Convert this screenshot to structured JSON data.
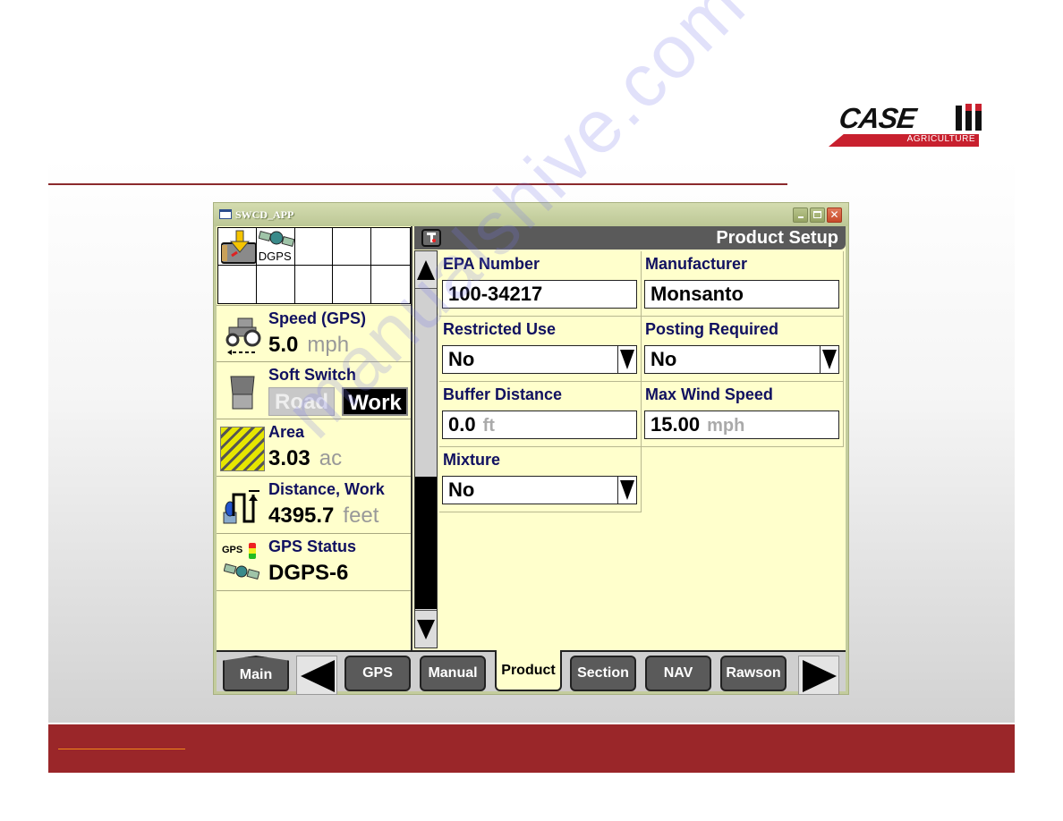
{
  "brand": {
    "logo_word": "CASE",
    "logo_sub": "AGRICULTURE",
    "accent_color": "#9a2629",
    "logo_red": "#c8202e"
  },
  "window": {
    "title": "SWCD_APP",
    "controls": [
      "minimize",
      "maximize",
      "close"
    ]
  },
  "header": {
    "title": "Product Setup",
    "icon": "tool-icon"
  },
  "status_grid": {
    "cells": [
      {
        "icon": "memory-card-download-icon",
        "label": ""
      },
      {
        "icon": "satellite-icon",
        "label": "DGPS"
      },
      {
        "icon": "",
        "label": ""
      },
      {
        "icon": "",
        "label": ""
      },
      {
        "icon": "",
        "label": ""
      },
      {
        "icon": "",
        "label": ""
      },
      {
        "icon": "",
        "label": ""
      },
      {
        "icon": "",
        "label": ""
      },
      {
        "icon": "",
        "label": ""
      },
      {
        "icon": "",
        "label": ""
      }
    ]
  },
  "stats": {
    "speed": {
      "label": "Speed (GPS)",
      "value": "5.0",
      "unit": "mph",
      "icon": "tractor-icon"
    },
    "soft_switch": {
      "label": "Soft Switch",
      "options": [
        "Road",
        "Work"
      ],
      "selected": "Work",
      "icon": "switch-icon"
    },
    "area": {
      "label": "Area",
      "value": "3.03",
      "unit": "ac",
      "icon": "hatched-area-icon"
    },
    "distance": {
      "label": "Distance, Work",
      "value": "4395.7",
      "unit": "feet",
      "icon": "distance-icon"
    },
    "gps_status": {
      "label": "GPS Status",
      "value": "DGPS-6",
      "icon_text": "GPS",
      "icon": "satellite-icon"
    }
  },
  "fields": {
    "epa_number": {
      "label": "EPA Number",
      "value": "100-34217"
    },
    "manufacturer": {
      "label": "Manufacturer",
      "value": "Monsanto"
    },
    "restricted_use": {
      "label": "Restricted Use",
      "value": "No"
    },
    "posting_required": {
      "label": "Posting Required",
      "value": "No"
    },
    "buffer_distance": {
      "label": "Buffer Distance",
      "value": "0.0",
      "unit": "ft"
    },
    "max_wind_speed": {
      "label": "Max Wind Speed",
      "value": "15.00",
      "unit": "mph"
    },
    "mixture": {
      "label": "Mixture",
      "value": "No"
    }
  },
  "tabs": [
    {
      "label": "Main",
      "active": false
    },
    {
      "label": "GPS",
      "active": false
    },
    {
      "label": "Manual",
      "active": false
    },
    {
      "label": "Product",
      "active": true
    },
    {
      "label": "Section",
      "active": false
    },
    {
      "label": "NAV",
      "active": false
    },
    {
      "label": "Rawson",
      "active": false
    }
  ],
  "watermark": "manualshive.com"
}
